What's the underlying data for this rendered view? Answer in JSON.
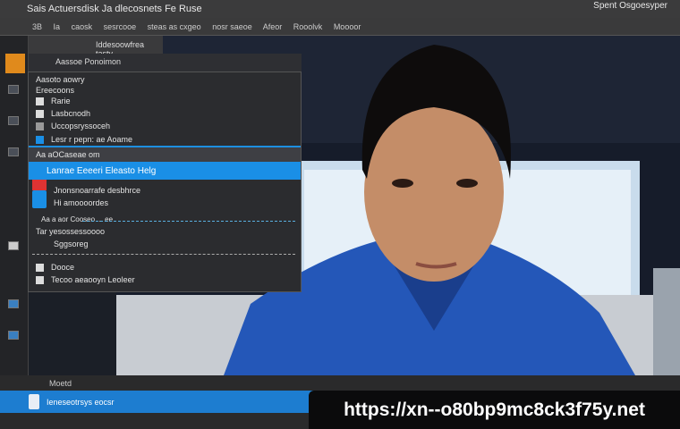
{
  "titlebar": {
    "title": "Sais Actuersdisk Ja dlecosnets  Fe Ruse",
    "right": "Spent Osgoesyper"
  },
  "menubar": [
    "3B",
    "Ia",
    "caosk",
    "sesrcooe",
    "steas as cxgeo",
    "nosr saeoe",
    "Afeor",
    "Rooolvk",
    "Moooor"
  ],
  "toolbar2": {
    "label": "Iddesoowfrea tasty"
  },
  "submenu_header": "Aassoe Ponoimon",
  "menu": {
    "items": [
      "Aasoto aowry",
      "Ereecoons",
      "Rarie",
      "Lasbcnodh",
      "Uccopsryssoceh",
      "Lesr r pepn: ae Aoame",
      "Aa aOCaseae om",
      "Lanrae Eeeeri Eleasto Helg",
      "Jnonsnoarrafe desbhrce",
      "Hi amoooordes",
      "Aa a aor Cooseo ... ee",
      "Tar yesossessoooo",
      "Sggsoreg",
      "Dooce",
      "Tecoo aeaooyn Leoleer"
    ],
    "highlighted": "Lanrae Eeeeri Eleasto Helg"
  },
  "bottombar": {
    "label": "Moetd"
  },
  "bluebar": {
    "label": "Ieneseotrsys eocsr"
  },
  "watermark": "https://xn--o80bp9mc8ck3f75y.net",
  "colors": {
    "accent": "#1a8fe6",
    "orange": "#e08a1c",
    "shirt": "#2457b8"
  }
}
